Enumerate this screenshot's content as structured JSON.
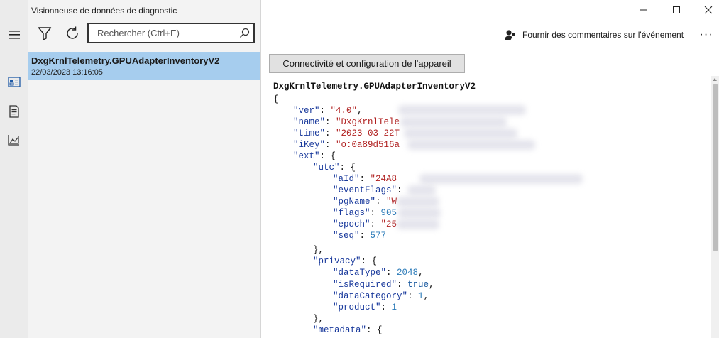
{
  "app": {
    "title": "Visionneuse de données de diagnostic"
  },
  "search": {
    "placeholder": "Rechercher (Ctrl+E)"
  },
  "event_list": [
    {
      "name": "DxgKrnlTelemetry.GPUAdapterInventoryV2",
      "time": "22/03/2023 13:16:05"
    }
  ],
  "detail": {
    "feedback_label": "Fournir des commentaires sur l'événement",
    "more_label": "···",
    "category_label": "Connectivité et configuration de l'appareil",
    "event_title": "DxgKrnlTelemetry.GPUAdapterInventoryV2",
    "json": {
      "open": "{",
      "ver": {
        "k": "\"ver\"",
        "v": "\"4.0\""
      },
      "name": {
        "k": "\"name\"",
        "v": "\"DxgKrnlTele"
      },
      "time": {
        "k": "\"time\"",
        "v": "\"2023-03-22T"
      },
      "iKey": {
        "k": "\"iKey\"",
        "v": "\"o:0a89d516a"
      },
      "ext": {
        "k": "\"ext\""
      },
      "utc": {
        "k": "\"utc\""
      },
      "aId": {
        "k": "\"aId\"",
        "v": "\"24A8"
      },
      "eventFlags": {
        "k": "\"eventFlags\""
      },
      "pgName": {
        "k": "\"pgName\"",
        "v": "\"W"
      },
      "flags": {
        "k": "\"flags\"",
        "v": "905"
      },
      "epoch": {
        "k": "\"epoch\"",
        "v": "\"25"
      },
      "seq": {
        "k": "\"seq\"",
        "v": "577"
      },
      "privacy": {
        "k": "\"privacy\""
      },
      "dataType": {
        "k": "\"dataType\"",
        "v": "2048"
      },
      "isRequired": {
        "k": "\"isRequired\"",
        "v": "true"
      },
      "dataCategory": {
        "k": "\"dataCategory\"",
        "v": "1"
      },
      "product": {
        "k": "\"product\"",
        "v": "1"
      },
      "metadata": {
        "k": "\"metadata\""
      }
    }
  },
  "colors": {
    "selected_bg": "#a6cdee",
    "json_key": "#1a3a9c",
    "json_string": "#b02020",
    "json_number": "#2a7ab8"
  }
}
